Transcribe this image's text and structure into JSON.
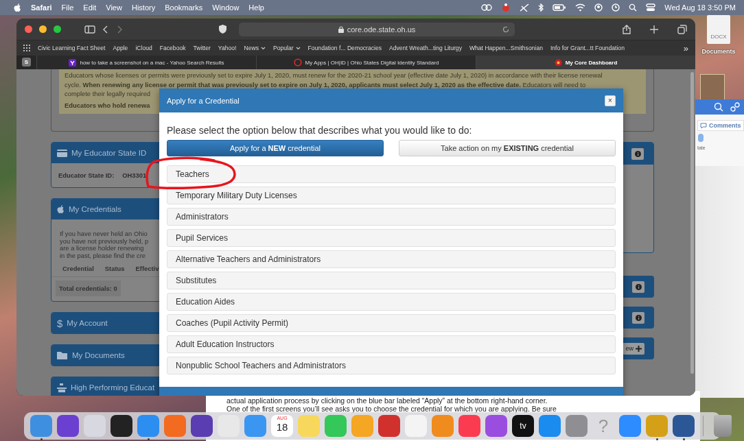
{
  "menu_bar": {
    "app": "Safari",
    "menus": [
      "File",
      "Edit",
      "View",
      "History",
      "Bookmarks",
      "Window",
      "Help"
    ],
    "clock": "Wed Aug 18  3:50 PM"
  },
  "desktop": {
    "file_badge": "DOCX",
    "folder_label": "Documents"
  },
  "browser": {
    "address": "core.ode.state.oh.us",
    "bookmarks": [
      {
        "label": "Civic Learning Fact Sheet",
        "dropdown": false
      },
      {
        "label": "Apple",
        "dropdown": false
      },
      {
        "label": "iCloud",
        "dropdown": false
      },
      {
        "label": "Facebook",
        "dropdown": false
      },
      {
        "label": "Twitter",
        "dropdown": false
      },
      {
        "label": "Yahoo!",
        "dropdown": false
      },
      {
        "label": "News",
        "dropdown": true
      },
      {
        "label": "Popular",
        "dropdown": true
      },
      {
        "label": "Foundation f... Democracies",
        "dropdown": false
      },
      {
        "label": "Advent Wreath...ting Liturgy",
        "dropdown": false
      },
      {
        "label": "What Happen...Smithsonian",
        "dropdown": false
      },
      {
        "label": "Info for Grant...tt Foundation",
        "dropdown": false
      }
    ],
    "bookmarks_overflow": "»",
    "sidebar_badge": "S",
    "tabs": [
      {
        "kind": "yahoo",
        "title": "how to take a screenshot on a mac - Yahoo Search Results",
        "selected": false
      },
      {
        "kind": "ring",
        "title": "My Apps | OH|ID | Ohio States Digital Identity Standard",
        "selected": false
      },
      {
        "kind": "badge",
        "title": "My Core Dashboard",
        "selected": true
      }
    ]
  },
  "page": {
    "notice": {
      "lines": [
        "Educators whose licenses or permits were previously set to expire July 1, 2020, must renew for the 2020-21 school year (effective date July 1, 2020) in accordance with their license renewal",
        "cycle. **When renewing any license or permit that was previously set to expire on July 1, 2020, applicants must select July 1, 2020 as the effective date.** Educators will need to",
        "complete their legally required"
      ],
      "emphasis": "Educators who hold renewa"
    },
    "left_panels": [
      {
        "kind": "id",
        "title": "My Educator State ID",
        "label": "Educator State ID:",
        "value": "OH3301"
      },
      {
        "kind": "credentials",
        "title": "My Credentials",
        "paragraph_lines": [
          "If you have never held an Ohio",
          "you have not previously held, p",
          "are a license holder renewing",
          "in the past, please find the cre"
        ],
        "columns": [
          "Credential",
          "Status",
          "Effectiv"
        ],
        "total": "Total credentials: 0"
      },
      {
        "kind": "account",
        "glyph": "$",
        "title": "My Account"
      },
      {
        "kind": "documents",
        "title": "My Documents"
      },
      {
        "kind": "performance",
        "title": "High Performing Educat"
      }
    ],
    "right_panels": [
      {
        "kind": "info"
      },
      {
        "kind": "info"
      },
      {
        "kind": "info"
      },
      {
        "kind": "action",
        "label": "ew"
      }
    ]
  },
  "dialog": {
    "title": "Apply for a Credential",
    "close": "×",
    "prompt": "Please select the option below that describes what you would like to do:",
    "choices": [
      {
        "label": "Apply for a **NEW** credential",
        "selected": true
      },
      {
        "label": "Take action on my **EXISTING** credential",
        "selected": false
      }
    ],
    "categories": [
      "Teachers",
      "Temporary Military Duty Licenses",
      "Administrators",
      "Pupil Services",
      "Alternative Teachers and Administrators",
      "Substitutes",
      "Education Aides",
      "Coaches (Pupil Activity Permit)",
      "Adult Education Instructors",
      "Nonpublic School Teachers and Administrators"
    ]
  },
  "side_window": {
    "comments": "Comments",
    "caption": "tate"
  },
  "document_lines": [
    "actual application process by clicking on the blue bar labeled “Apply” at the bottom right-hand corner.",
    "One of the first screens you’ll see asks you to choose the credential for which you are applying. Be sure"
  ],
  "dock": [
    {
      "kind": "tile",
      "color": "#3f8fe0",
      "running": true
    },
    {
      "kind": "tile",
      "color": "#6b3fd0",
      "running": false
    },
    {
      "kind": "tile",
      "color": "#d8d8e0",
      "running": false
    },
    {
      "kind": "tile",
      "color": "#222222",
      "running": false
    },
    {
      "kind": "tile",
      "color": "#2c8ef0",
      "running": true
    },
    {
      "kind": "tile",
      "color": "#f26b21",
      "running": false
    },
    {
      "kind": "tile",
      "color": "#5a3db0",
      "running": false
    },
    {
      "kind": "tile",
      "color": "#e8e8e8",
      "running": false
    },
    {
      "kind": "tile",
      "color": "#3b96f2",
      "running": false
    },
    {
      "kind": "calendar",
      "month": "AUG",
      "day": "18",
      "running": false
    },
    {
      "kind": "tile",
      "color": "#f8d85c",
      "running": false
    },
    {
      "kind": "tile",
      "color": "#34c759",
      "running": false
    },
    {
      "kind": "tile",
      "color": "#f5a623",
      "running": false
    },
    {
      "kind": "tile",
      "color": "#d0312d",
      "running": false
    },
    {
      "kind": "tile",
      "color": "#f4f4f4",
      "running": false
    },
    {
      "kind": "tile",
      "color": "#f08c1e",
      "running": false
    },
    {
      "kind": "tile",
      "color": "#fb3c50",
      "running": false
    },
    {
      "kind": "tile",
      "color": "#9a4ee0",
      "running": false
    },
    {
      "kind": "label",
      "color": "#111111",
      "text": "tv",
      "running": false
    },
    {
      "kind": "tile",
      "color": "#1a8cf0",
      "running": false
    },
    {
      "kind": "tile",
      "color": "#8e8e93",
      "running": false
    },
    {
      "kind": "glyph",
      "text": "?",
      "running": false
    },
    {
      "kind": "tile",
      "color": "#2d8cff",
      "running": false
    },
    {
      "kind": "tile",
      "color": "#d4a017",
      "running": true
    },
    {
      "kind": "tile",
      "color": "#2b5797",
      "running": true
    },
    {
      "kind": "trash",
      "running": false
    }
  ]
}
